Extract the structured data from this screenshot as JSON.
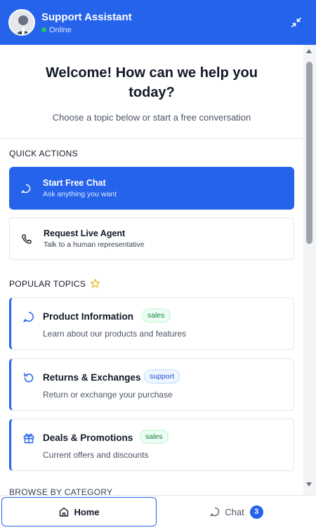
{
  "header": {
    "title": "Support Assistant",
    "status": "Online"
  },
  "welcome": {
    "title": "Welcome! How can we help you today?",
    "subtitle": "Choose a topic below or start a free conversation"
  },
  "quick_actions": {
    "label": "QUICK ACTIONS",
    "items": [
      {
        "title": "Start Free Chat",
        "subtitle": "Ask anything you want",
        "icon": "chat-bubble-icon"
      },
      {
        "title": "Request Live Agent",
        "subtitle": "Talk to a human representative",
        "icon": "phone-icon"
      }
    ]
  },
  "popular_topics": {
    "label": "POPULAR TOPICS",
    "items": [
      {
        "title": "Product Information",
        "badge": "sales",
        "desc": "Learn about our products and features",
        "icon": "chat-bubble-icon"
      },
      {
        "title": "Returns & Exchanges",
        "badge": "support",
        "desc": "Return or exchange your purchase",
        "icon": "refresh-icon"
      },
      {
        "title": "Deals & Promotions",
        "badge": "sales",
        "desc": "Current offers and discounts",
        "icon": "gift-icon"
      }
    ]
  },
  "browse": {
    "label": "BROWSE BY CATEGORY"
  },
  "footer": {
    "home_label": "Home",
    "chat_label": "Chat",
    "chat_count": "3"
  },
  "colors": {
    "accent": "#2563eb",
    "online": "#22c55e",
    "star": "#eab308"
  }
}
